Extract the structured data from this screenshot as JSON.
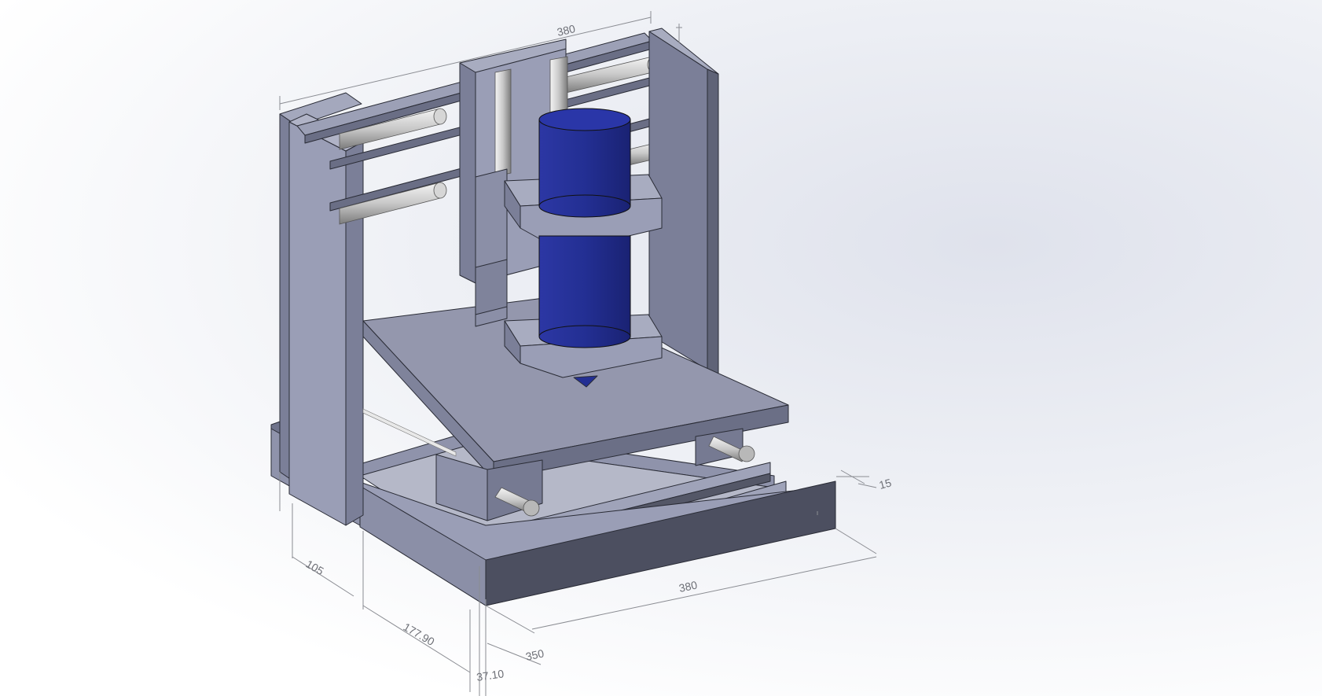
{
  "dimensions": {
    "top_width": "380",
    "base_length": "380",
    "bottom_width": "350",
    "height_a": "177.90",
    "height_b": "105",
    "offset": "37.10",
    "thickness": "15"
  },
  "colors": {
    "frame_top": "#9a9eb6",
    "frame_side": "#7b7f98",
    "frame_dark": "#5a5d70",
    "rod": "#c9c9c9",
    "spindle": "#232f93",
    "spindle_highlight": "#3340b0",
    "background": "#eef0f5"
  }
}
